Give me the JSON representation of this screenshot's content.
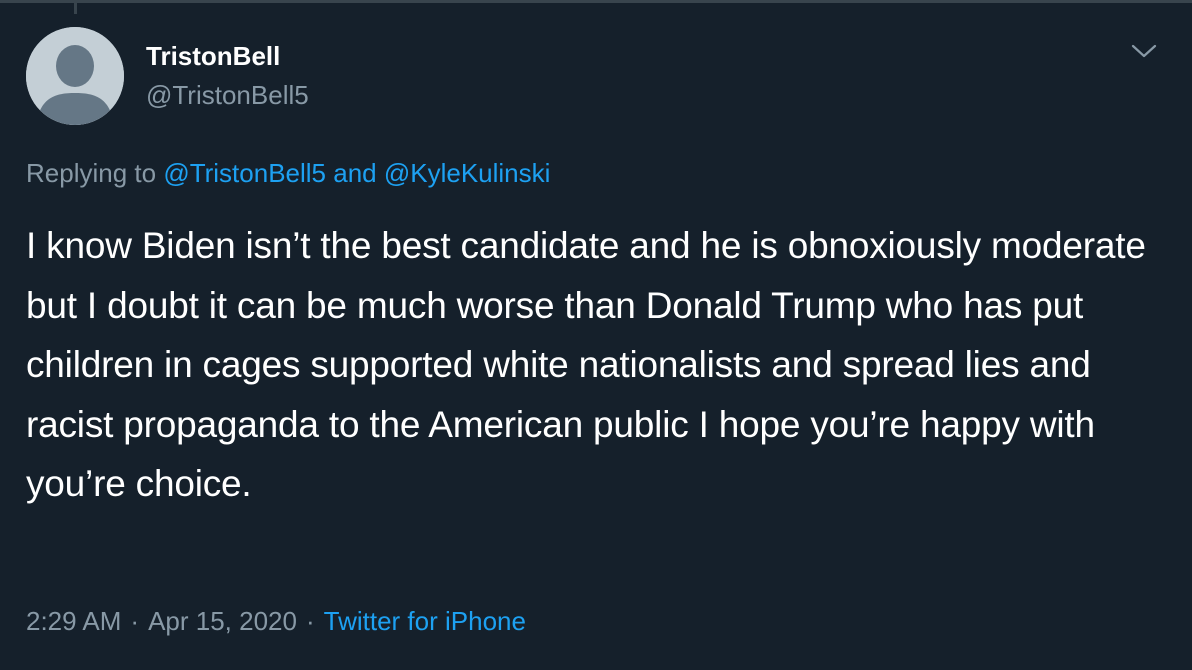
{
  "tweet": {
    "display_name": "TristonBell",
    "handle": "@TristonBell5",
    "replying_prefix": "Replying to ",
    "replying_mention_1": "@TristonBell5",
    "replying_and": " and ",
    "replying_mention_2": "@KyleKulinski",
    "text": "I know Biden isn’t the best candidate and he is obnoxiously moderate but I doubt it can be much worse than Donald Trump who has put children in cages supported white nationalists and spread lies and racist propaganda to the American public I hope you’re happy with you’re choice.",
    "time": "2:29 AM",
    "separator": "·",
    "date": "Apr 15, 2020",
    "source": "Twitter for iPhone"
  },
  "icons": {
    "avatar": "default-avatar-icon",
    "menu": "chevron-down-icon"
  },
  "colors": {
    "background": "#15202b",
    "text_primary": "#ffffff",
    "text_secondary": "#8899a6",
    "accent": "#1da1f2"
  }
}
